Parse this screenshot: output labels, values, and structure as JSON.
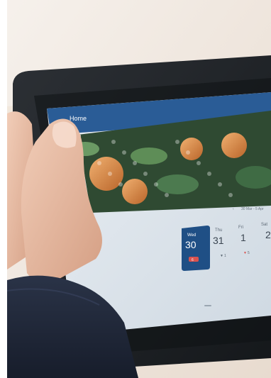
{
  "app": {
    "title": "Home"
  },
  "calendar": {
    "range_label": "30 Mar - 5 Apr",
    "days": [
      {
        "name": "Wed",
        "num": "30",
        "badge": "6",
        "selected": true
      },
      {
        "name": "Thu",
        "num": "31",
        "badge": "1",
        "selected": false
      },
      {
        "name": "Fri",
        "num": "1",
        "badge": "5",
        "selected": false
      },
      {
        "name": "Sat",
        "num": "2",
        "badge": "",
        "selected": false
      }
    ]
  },
  "colors": {
    "header_blue": "#2a5c96",
    "selected_day": "#1f4f85",
    "badge_red": "#d9534f",
    "bezel": "#1f2226",
    "screen_bg": "#dfe7ee"
  }
}
